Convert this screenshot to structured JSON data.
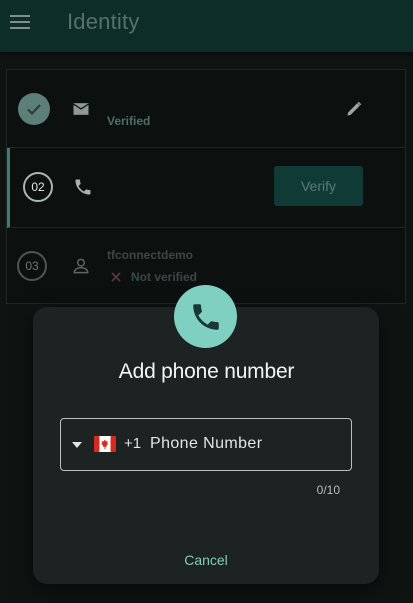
{
  "app": {
    "title": "Identity",
    "accent": "#7fd0c0",
    "appbar_color": "#0d2d29"
  },
  "icons": {
    "menu": "hamburger-menu-icon",
    "email": "email-icon",
    "edit": "pencil-icon",
    "phone": "phone-icon",
    "person": "person-icon",
    "close": "close-x-icon",
    "check": "check-icon",
    "dropdown": "triangle-down-icon",
    "flag": "canada-flag-icon"
  },
  "steps": [
    {
      "status": "Verified"
    },
    {
      "number": "02",
      "verify_label": "Verify"
    },
    {
      "number": "03",
      "name": "tfconnectdemo",
      "status": "Not verified"
    }
  ],
  "dialog": {
    "title": "Add phone number",
    "dial_code": "+1",
    "phone_placeholder": "Phone Number",
    "phone_value": "",
    "counter": "0/10",
    "cancel_label": "Cancel"
  }
}
